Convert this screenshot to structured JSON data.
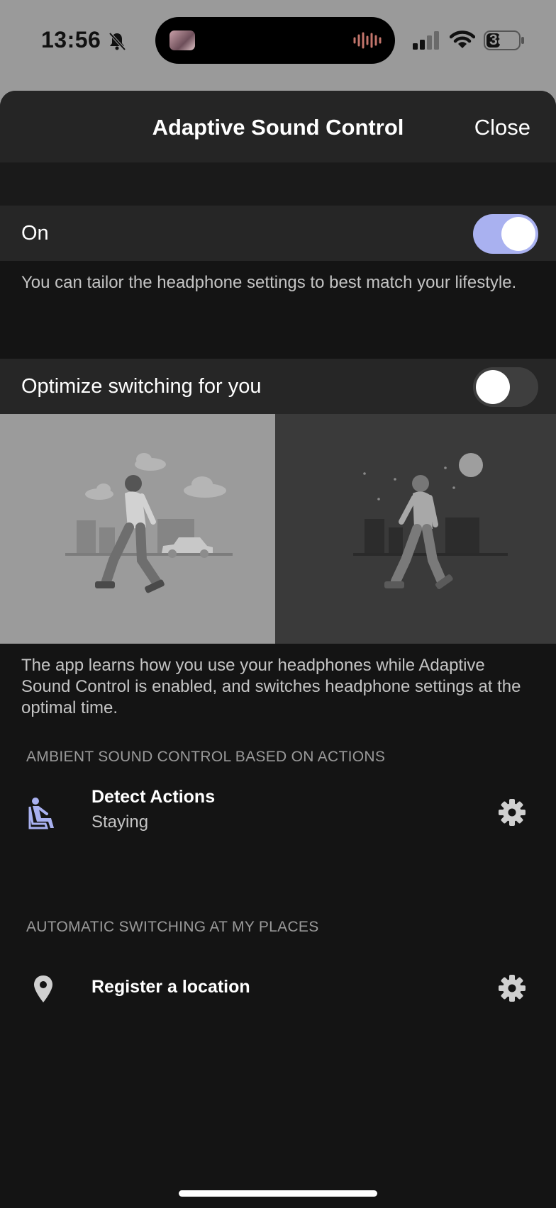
{
  "status": {
    "time": "13:56",
    "battery": "38"
  },
  "header": {
    "title": "Adaptive Sound Control",
    "close_label": "Close"
  },
  "main_toggle": {
    "label": "On",
    "state": "on",
    "description": "You can tailor the headphone settings to best match your lifestyle."
  },
  "optimize": {
    "label": "Optimize switching for you",
    "state": "off",
    "description": "The app learns how you use your headphones while Adaptive Sound Control is enabled, and switches headphone settings at the optimal time."
  },
  "actions_section": {
    "header": "AMBIENT SOUND CONTROL BASED ON ACTIONS",
    "item": {
      "title": "Detect Actions",
      "subtitle": "Staying",
      "icon": "sitting-person-icon"
    }
  },
  "places_section": {
    "header": "AUTOMATIC SWITCHING AT MY PLACES",
    "item": {
      "title": "Register a location",
      "icon": "location-pin-icon"
    }
  },
  "colors": {
    "accent": "#a9b1f0",
    "background": "#141414",
    "row": "#262626"
  }
}
